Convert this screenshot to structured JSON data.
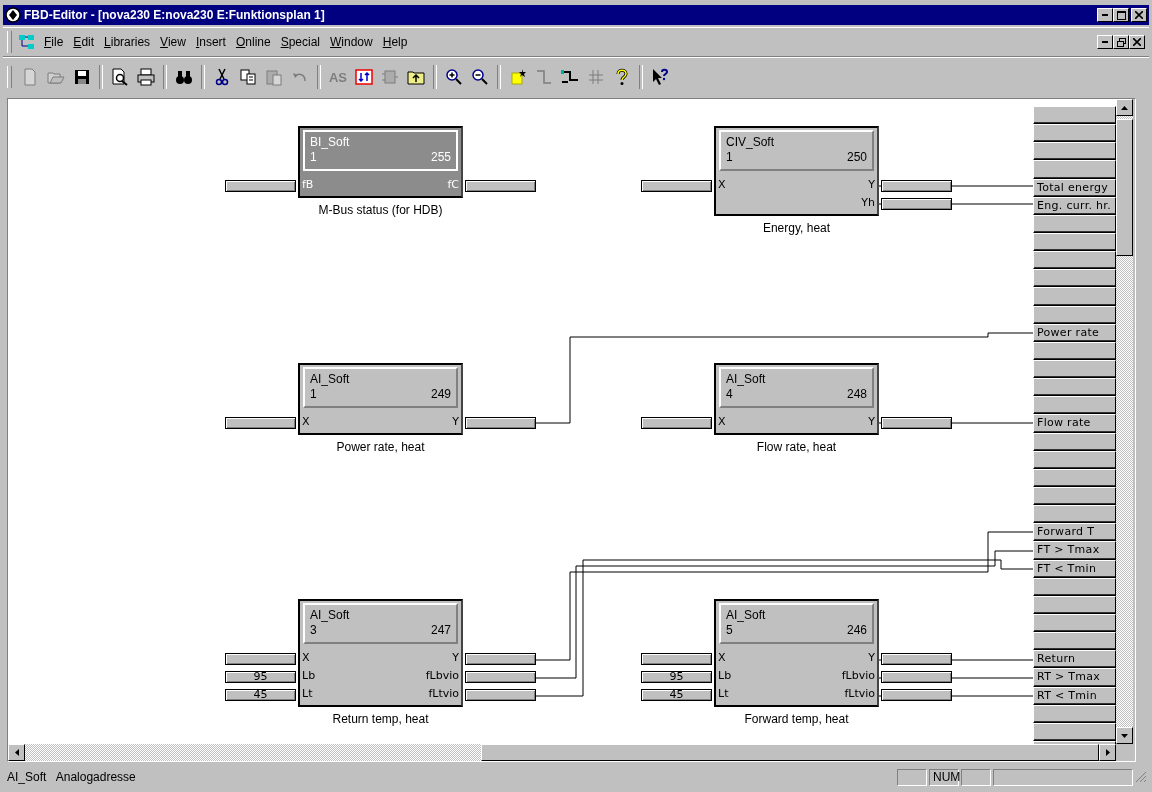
{
  "window": {
    "title": "FBD-Editor - [nova230 E:nova230 E:Funktionsplan 1]"
  },
  "menu": [
    "File",
    "Edit",
    "Libraries",
    "View",
    "Insert",
    "Online",
    "Special",
    "Window",
    "Help"
  ],
  "toolbar": [
    {
      "kind": "new",
      "disabled": true
    },
    {
      "kind": "open",
      "disabled": true
    },
    {
      "kind": "save",
      "disabled": false
    },
    {
      "kind": "separator"
    },
    {
      "kind": "preview",
      "disabled": false
    },
    {
      "kind": "print",
      "disabled": false
    },
    {
      "kind": "separator"
    },
    {
      "kind": "find",
      "disabled": false
    },
    {
      "kind": "separator"
    },
    {
      "kind": "cut",
      "disabled": false
    },
    {
      "kind": "copy",
      "disabled": false
    },
    {
      "kind": "paste",
      "disabled": true
    },
    {
      "kind": "undo",
      "disabled": true
    },
    {
      "kind": "separator"
    },
    {
      "kind": "text",
      "label": "AS",
      "disabled": true
    },
    {
      "kind": "swap",
      "disabled": false
    },
    {
      "kind": "block",
      "disabled": true
    },
    {
      "kind": "folder-up",
      "disabled": false
    },
    {
      "kind": "separator"
    },
    {
      "kind": "zoom-in",
      "disabled": false
    },
    {
      "kind": "zoom-out",
      "disabled": false
    },
    {
      "kind": "separator"
    },
    {
      "kind": "new-block",
      "disabled": false
    },
    {
      "kind": "connector",
      "disabled": true
    },
    {
      "kind": "wire",
      "disabled": false
    },
    {
      "kind": "grid",
      "disabled": true
    },
    {
      "kind": "help",
      "disabled": false
    },
    {
      "kind": "separator"
    },
    {
      "kind": "context-help",
      "disabled": false
    }
  ],
  "blocks": [
    {
      "type": "BI_Soft",
      "number": "1",
      "address": "255",
      "inactive": true,
      "label": "M-Bus status (for HDB)",
      "inputs": [
        {
          "name": "fB"
        }
      ],
      "outputs": [
        {
          "name": "fC"
        }
      ]
    },
    {
      "type": "CIV_Soft",
      "number": "1",
      "address": "250",
      "inactive": false,
      "label": "Energy, heat",
      "inputs": [
        {
          "name": "X"
        }
      ],
      "outputs": [
        {
          "name": "Y"
        },
        {
          "name": "Yh"
        }
      ]
    },
    {
      "type": "AI_Soft",
      "number": "1",
      "address": "249",
      "inactive": false,
      "label": "Power rate, heat",
      "inputs": [
        {
          "name": "X"
        }
      ],
      "outputs": [
        {
          "name": "Y"
        }
      ]
    },
    {
      "type": "AI_Soft",
      "number": "4",
      "address": "248",
      "inactive": false,
      "label": "Flow rate, heat",
      "inputs": [
        {
          "name": "X"
        }
      ],
      "outputs": [
        {
          "name": "Y"
        }
      ]
    },
    {
      "type": "AI_Soft",
      "number": "3",
      "address": "247",
      "inactive": false,
      "label": "Return temp, heat",
      "inputs": [
        {
          "name": "X"
        },
        {
          "name": "Lb",
          "value": "95"
        },
        {
          "name": "Lt",
          "value": "45"
        }
      ],
      "outputs": [
        {
          "name": "Y"
        },
        {
          "name": "fLbvio"
        },
        {
          "name": "fLtvio"
        }
      ]
    },
    {
      "type": "AI_Soft",
      "number": "5",
      "address": "246",
      "inactive": false,
      "label": "Forward temp, heat",
      "inputs": [
        {
          "name": "X"
        },
        {
          "name": "Lb",
          "value": "95"
        },
        {
          "name": "Lt",
          "value": "45"
        }
      ],
      "outputs": [
        {
          "name": "Y"
        },
        {
          "name": "fLbvio"
        },
        {
          "name": "fLtvio"
        }
      ]
    }
  ],
  "signals": [
    {
      "kind": "empty"
    },
    {
      "kind": "empty"
    },
    {
      "kind": "empty"
    },
    {
      "kind": "empty"
    },
    {
      "kind": "labeled",
      "label": "Total energy"
    },
    {
      "kind": "labeled",
      "label": "Eng. curr. hr."
    },
    {
      "kind": "empty"
    },
    {
      "kind": "empty"
    },
    {
      "kind": "empty"
    },
    {
      "kind": "empty"
    },
    {
      "kind": "empty"
    },
    {
      "kind": "empty"
    },
    {
      "kind": "labeled",
      "label": "Power rate"
    },
    {
      "kind": "empty"
    },
    {
      "kind": "empty"
    },
    {
      "kind": "empty"
    },
    {
      "kind": "empty"
    },
    {
      "kind": "labeled",
      "label": "Flow rate"
    },
    {
      "kind": "empty"
    },
    {
      "kind": "empty"
    },
    {
      "kind": "empty"
    },
    {
      "kind": "empty"
    },
    {
      "kind": "empty"
    },
    {
      "kind": "labeled",
      "label": "Forward T"
    },
    {
      "kind": "labeled",
      "label": "FT > Tmax"
    },
    {
      "kind": "labeled",
      "label": "FT < Tmin"
    },
    {
      "kind": "empty"
    },
    {
      "kind": "empty"
    },
    {
      "kind": "empty"
    },
    {
      "kind": "empty"
    },
    {
      "kind": "labeled",
      "label": "Return"
    },
    {
      "kind": "labeled",
      "label": "RT > Tmax"
    },
    {
      "kind": "labeled",
      "label": "RT < Tmin"
    },
    {
      "kind": "empty"
    },
    {
      "kind": "empty"
    },
    {
      "kind": "empty"
    }
  ],
  "status_bar": {
    "message": "AI_Soft   Analogadresse",
    "indicator": "NUM"
  }
}
